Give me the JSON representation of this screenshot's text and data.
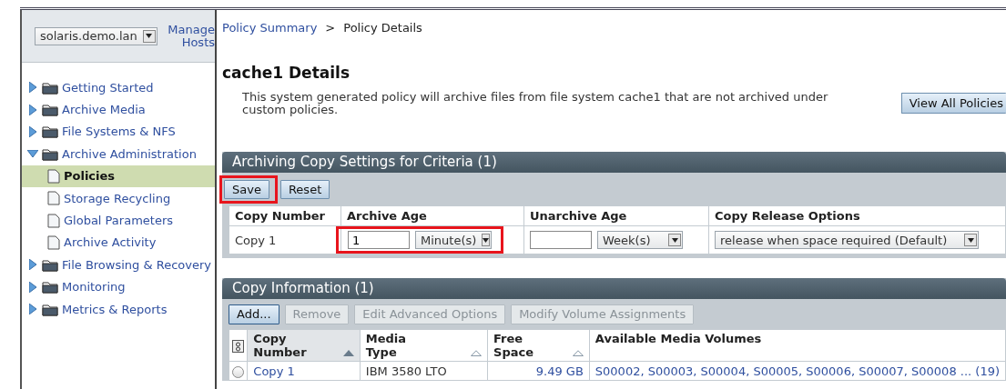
{
  "sidebar": {
    "host_select": {
      "value": "solaris.demo.lan"
    },
    "manage_link": "Manage Hosts",
    "tree": [
      {
        "label": "Getting Started",
        "kind": "folder",
        "expanded": false,
        "selected": false
      },
      {
        "label": "Archive Media",
        "kind": "folder",
        "expanded": false,
        "selected": false
      },
      {
        "label": "File Systems & NFS",
        "kind": "folder",
        "expanded": false,
        "selected": false
      },
      {
        "label": "Archive Administration",
        "kind": "folder",
        "expanded": true,
        "selected": false,
        "children": [
          {
            "label": "Policies",
            "kind": "page",
            "selected": true
          },
          {
            "label": "Storage Recycling",
            "kind": "page",
            "selected": false
          },
          {
            "label": "Global Parameters",
            "kind": "page",
            "selected": false
          },
          {
            "label": "Archive Activity",
            "kind": "page",
            "selected": false
          }
        ]
      },
      {
        "label": "File Browsing & Recovery",
        "kind": "folder",
        "expanded": false,
        "selected": false
      },
      {
        "label": "Monitoring",
        "kind": "folder",
        "expanded": false,
        "selected": false
      },
      {
        "label": "Metrics & Reports",
        "kind": "folder",
        "expanded": false,
        "selected": false
      }
    ]
  },
  "breadcrumb": [
    {
      "label": "Policy Summary",
      "kind": "link"
    },
    {
      "label": ">",
      "kind": "separator"
    },
    {
      "label": "Policy Details",
      "kind": "current"
    }
  ],
  "heading": "cache1 Details",
  "description": "This system generated policy will archive files from file system cache1 that are not archived under custom policies.",
  "view_all_button": "View All Policies",
  "settings_panel": {
    "title": "Archiving Copy Settings for Criteria (1)",
    "buttons": [
      {
        "label": "Save",
        "disabled": false,
        "highlighted": true
      },
      {
        "label": "Reset",
        "disabled": false,
        "highlighted": false
      }
    ],
    "columns": [
      "Copy Number",
      "Archive Age",
      "Unarchive Age",
      "Copy Release Options"
    ],
    "row": {
      "copy": "Copy 1",
      "archive_age": {
        "value": "1",
        "unit": "Minute(s)",
        "highlighted": true
      },
      "unarchive_age": {
        "unit": "Week(s)"
      },
      "release": "release when space required (Default)"
    }
  },
  "copy_panel": {
    "title": "Copy Information (1)",
    "buttons": [
      {
        "label": "Add...",
        "disabled": false
      },
      {
        "label": "Remove",
        "disabled": true
      },
      {
        "label": "Edit Advanced Options",
        "disabled": true
      },
      {
        "label": "Modify Volume Assignments",
        "disabled": true
      }
    ],
    "columns": [
      {
        "label": "Copy Number",
        "kind": "sortable",
        "sorted": true
      },
      {
        "label": "Media Type",
        "kind": "sortable",
        "sorted": false
      },
      {
        "label": "Free Space",
        "kind": "sortable",
        "sorted": false
      },
      {
        "label": "Available Media Volumes",
        "kind": "plain"
      }
    ],
    "rows": [
      {
        "selected": false,
        "copy": "Copy 1",
        "media_type": "IBM 3580 LTO",
        "free_space": "9.49 GB",
        "volumes": "S00002, S00003, S00004, S00005, S00006, S00007, S00008 ... (19)"
      }
    ]
  }
}
